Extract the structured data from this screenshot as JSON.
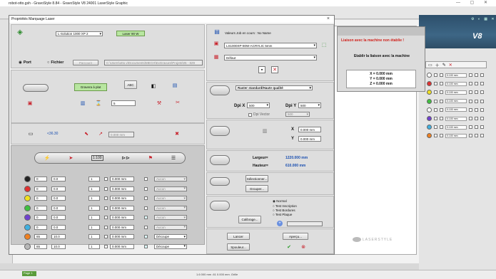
{
  "app": {
    "title": "robot-otto.gsh - GravoStyle 8.84 - GravoStyle V8 24001 LaserStyle Graphic",
    "win_controls": "— ▢ ✕",
    "logo": "V8",
    "status_page_tab": "Page 1",
    "status_coords": "1.6 000 mm   .61 0.000 mm   .Grille",
    "laserstyle_logo": "LASERSTYLE"
  },
  "layers": [
    {
      "color": "#ffffff",
      "value": "0.100 mm"
    },
    {
      "color": "#e03030",
      "value": "0.100 mm"
    },
    {
      "color": "#f0e020",
      "value": "0.100 mm"
    },
    {
      "color": "#40c040",
      "value": "0.100 mm"
    },
    {
      "color": "#ffffff",
      "value": "0.100 mm"
    },
    {
      "color": "#7040d0",
      "value": "0.100 mm"
    },
    {
      "color": "#40b0e0",
      "value": "0.100 mm"
    },
    {
      "color": "#f08020",
      "value": "0.100 mm"
    }
  ],
  "dialog": {
    "title": "Propriétés Marquage Laser",
    "close": "×",
    "machine_select": "L-Solution 1000 XP 2",
    "power_badge": "Laser 90 W",
    "port_label": "Port",
    "file_label": "Fichier",
    "browse_label": "Parcourir",
    "file_path": "C:\\Users\\otto.v\\Documents\\MECH\\ExGravure\\Projets\\05 - 829",
    "job_label": "Valeurs Job en cours : No Name",
    "material_select": "LS1000XP-80W-ACRYLIC 5mm",
    "default_select": "Défaut",
    "mode_badge": "Gravera à plat",
    "abc_label": "ABC",
    "value_36": "<36.30",
    "field_val": "5",
    "raster_quality": "Raster standard/Haute qualité",
    "dpi_x_label": "Dpi X",
    "dpi_x": "500",
    "dpi_y_label": "Dpi Y",
    "dpi_y": "500",
    "dpi_vector_label": "Dpi Vector",
    "dpi_vector": "500",
    "pos_x_label": "X",
    "pos_x": "0.000 mm",
    "pos_y_label": "Y",
    "pos_y": "0.000 mm",
    "width_label": "Largeur=",
    "width_value": "1220.000 mm",
    "height_label": "Hauteur=",
    "height_value": "610.000 mm",
    "select_button": "Sélectionner...",
    "group_button": "Grouper...",
    "mode_normal": "Normal",
    "mode_text_inscription": "Test Inscription",
    "mode_test_bordures": "Test Bordures",
    "mode_test_plaque": "Test Plaque",
    "calibrage_button": "Calibrage...",
    "launch_button": "Lancer",
    "preview_button": "Aperçu...",
    "spooler_button": "Spouleur...",
    "ratio_label": "1:100"
  },
  "color_rows": [
    {
      "color": "#222222",
      "power": "0",
      "speed": "0.0",
      "passes": "1",
      "offset": "0.000 mm",
      "checked": false,
      "mode": "Aucun"
    },
    {
      "color": "#e03030",
      "power": "0",
      "speed": "0.0",
      "passes": "1",
      "offset": "0.000 mm",
      "checked": false,
      "mode": "Aucun"
    },
    {
      "color": "#f0e020",
      "power": "0",
      "speed": "0.0",
      "passes": "1",
      "offset": "0.000 mm",
      "checked": false,
      "mode": "Aucun"
    },
    {
      "color": "#40c040",
      "power": "0",
      "speed": "0.0",
      "passes": "1",
      "offset": "0.000 mm",
      "checked": false,
      "mode": "Aucun"
    },
    {
      "color": "#7040d0",
      "power": "0",
      "speed": "0.0",
      "passes": "1",
      "offset": "0.000 mm",
      "checked": true,
      "mode": "Aucun"
    },
    {
      "color": "#40b0e0",
      "power": "0",
      "speed": "0.0",
      "passes": "1",
      "offset": "0.000 mm",
      "checked": false,
      "mode": "Aucun"
    },
    {
      "color": "#f08020",
      "power": "65",
      "speed": "10.0",
      "passes": "1",
      "offset": "0.000 mm",
      "checked": true,
      "mode": "Découpe"
    },
    {
      "color": "#b8b8b8",
      "power": "65",
      "speed": "10.0",
      "passes": "1",
      "offset": "0.000 mm",
      "checked": true,
      "mode": "Découpe"
    }
  ],
  "connection": {
    "title": "Liaison avec la machine non établie !",
    "message": "Etablir la liaison avec la machine",
    "x": "X = 0.000 mm",
    "y": "Y = 0.000 mm",
    "z": "Z = 0.000 mm"
  }
}
